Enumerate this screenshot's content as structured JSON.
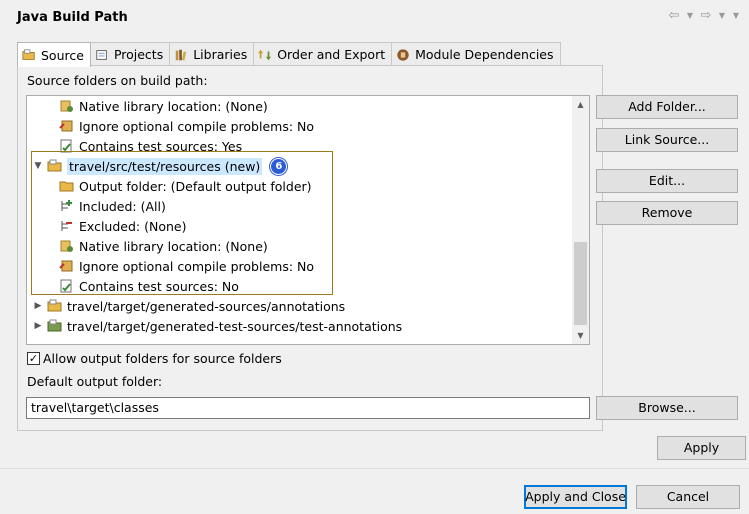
{
  "window": {
    "title": "Java Build Path"
  },
  "nav": {
    "back_icon": "back-arrow-icon",
    "forward_icon": "forward-arrow-icon"
  },
  "tabs": [
    {
      "label": "Source",
      "icon": "source-folder-icon",
      "active": true
    },
    {
      "label": "Projects",
      "icon": "projects-icon",
      "active": false
    },
    {
      "label": "Libraries",
      "icon": "libraries-icon",
      "active": false
    },
    {
      "label": "Order and Export",
      "icon": "order-export-icon",
      "active": false
    },
    {
      "label": "Module Dependencies",
      "icon": "module-icon",
      "active": false
    }
  ],
  "source": {
    "heading": "Source folders on build path:",
    "tree": [
      {
        "label": "Native library location: (None)",
        "icon": "native-library-icon"
      },
      {
        "label": "Ignore optional compile problems: No",
        "icon": "ignore-problems-icon"
      },
      {
        "label": "Contains test sources: Yes",
        "icon": "test-sources-icon"
      },
      {
        "label": "travel/src/test/resources (new)",
        "icon": "source-folder-icon",
        "badge": "6"
      },
      {
        "label": "Output folder: (Default output folder)",
        "icon": "output-folder-icon"
      },
      {
        "label": "Included: (All)",
        "icon": "included-icon"
      },
      {
        "label": "Excluded: (None)",
        "icon": "excluded-icon"
      },
      {
        "label": "Native library location: (None)",
        "icon": "native-library-icon"
      },
      {
        "label": "Ignore optional compile problems: No",
        "icon": "ignore-problems-icon"
      },
      {
        "label": "Contains test sources: No",
        "icon": "test-sources-icon"
      },
      {
        "label": "travel/target/generated-sources/annotations",
        "icon": "source-folder-icon"
      },
      {
        "label": "travel/target/generated-test-sources/test-annotations",
        "icon": "test-source-folder-icon"
      }
    ],
    "allow_output_label": "Allow output folders for source folders",
    "allow_output_checked": true,
    "default_output_label": "Default output folder:",
    "default_output_value": "travel\\target\\classes"
  },
  "buttons": {
    "add_folder": "Add Folder...",
    "link_source": "Link Source...",
    "edit": "Edit...",
    "remove": "Remove",
    "browse": "Browse...",
    "apply": "Apply",
    "apply_close": "Apply and Close",
    "cancel": "Cancel"
  },
  "colors": {
    "selection": "#cce8ff",
    "highlight_border": "#9a7c1e",
    "badge": "#2c5bd6"
  }
}
